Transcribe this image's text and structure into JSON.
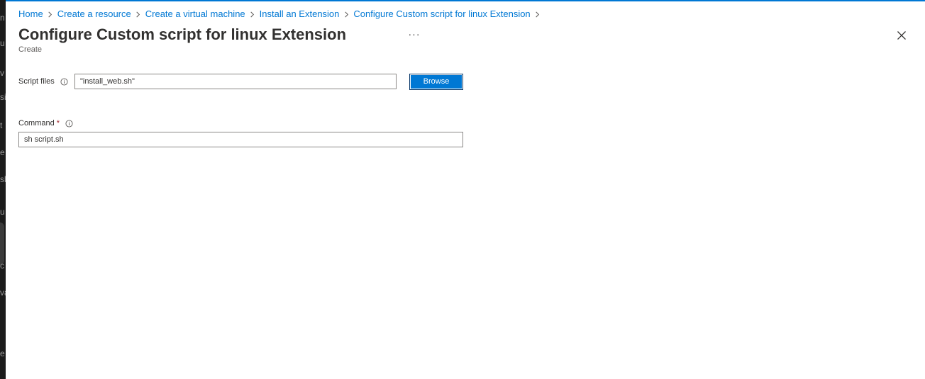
{
  "breadcrumb": [
    {
      "label": "Home"
    },
    {
      "label": "Create a resource"
    },
    {
      "label": "Create a virtual machine"
    },
    {
      "label": "Install an Extension"
    },
    {
      "label": "Configure Custom script for linux Extension"
    }
  ],
  "header": {
    "title": "Configure Custom script for linux Extension",
    "subtitle": "Create",
    "more_label": "···"
  },
  "form": {
    "script_files": {
      "label": "Script files",
      "value": "\"install_web.sh\"",
      "browse_label": "Browse"
    },
    "command": {
      "label": "Command",
      "required_mark": "*",
      "value": "sh script.sh"
    }
  },
  "background_fragments": [
    "n",
    "u",
    "v",
    "si",
    "t",
    "e",
    "sl",
    "u",
    "c",
    "va",
    "e"
  ],
  "colors": {
    "accent": "#0078d4",
    "required": "#a4262c",
    "text": "#323130",
    "left_strip": "#1b1b1b"
  },
  "icons": {
    "close": "close-icon",
    "info": "info-icon",
    "chevron": "chevron-right-icon"
  }
}
